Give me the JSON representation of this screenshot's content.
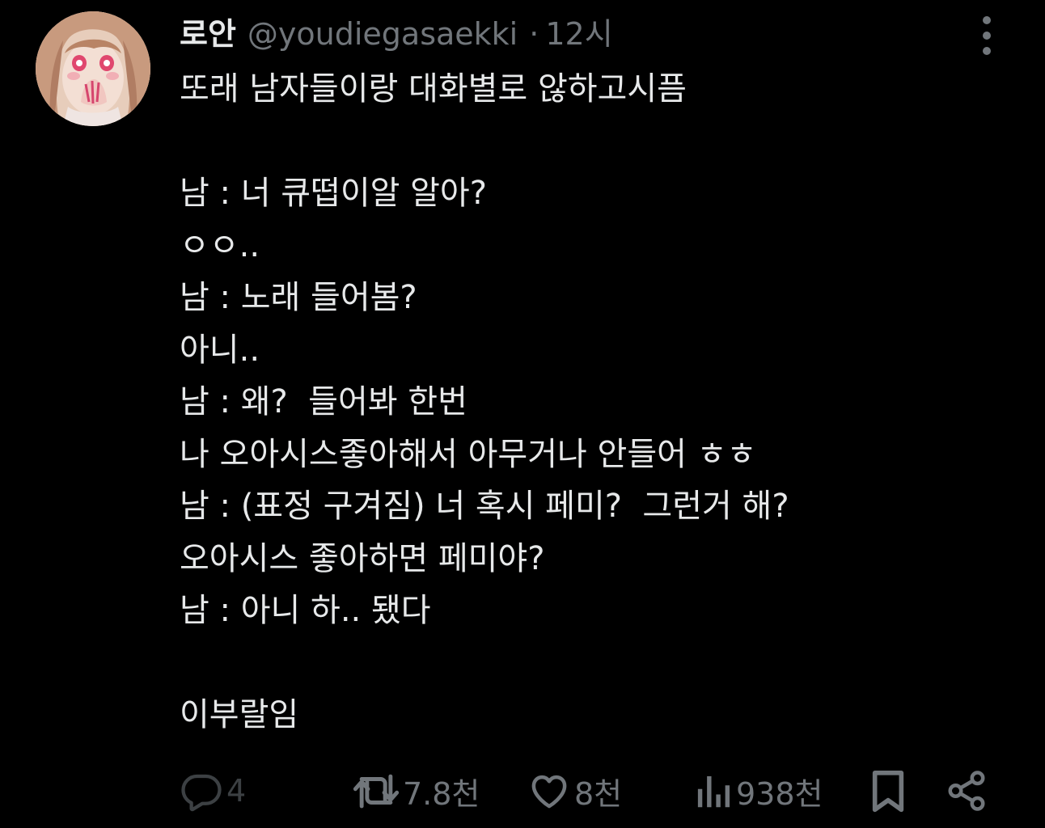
{
  "tweet": {
    "display_name": "로안",
    "handle": "@youdiegasaekki",
    "separator": "·",
    "time": "12시",
    "lines": [
      "또래 남자들이랑 대화별로 않하고시픔",
      "",
      "남 : 너 큐떱이알 알아?",
      "ㅇㅇ..",
      "남 : 노래 들어봄?",
      "아니..",
      "남 : 왜?  들어봐 한번",
      "나 오아시스좋아해서 아무거나 안들어 ㅎㅎ",
      "남 : (표정 구겨짐) 너 혹시 페미?  그런거 해?",
      "오아시스 좋아하면 페미야?",
      "남 : 아니 하.. 됐다",
      "",
      "이부랄임"
    ]
  },
  "actions": {
    "reply_count": "4",
    "retweet_count": "7.8천",
    "like_count": "8천",
    "views_count": "938천"
  },
  "icons": {
    "avatar": "avatar-anime-girl",
    "more": "more-vertical-icon",
    "reply": "reply-icon",
    "retweet": "retweet-icon",
    "like": "heart-icon",
    "views": "views-icon",
    "bookmark": "bookmark-icon",
    "share": "share-icon"
  },
  "colors": {
    "background": "#000000",
    "text_primary": "#e7e9ea",
    "text_secondary": "#71767b"
  }
}
